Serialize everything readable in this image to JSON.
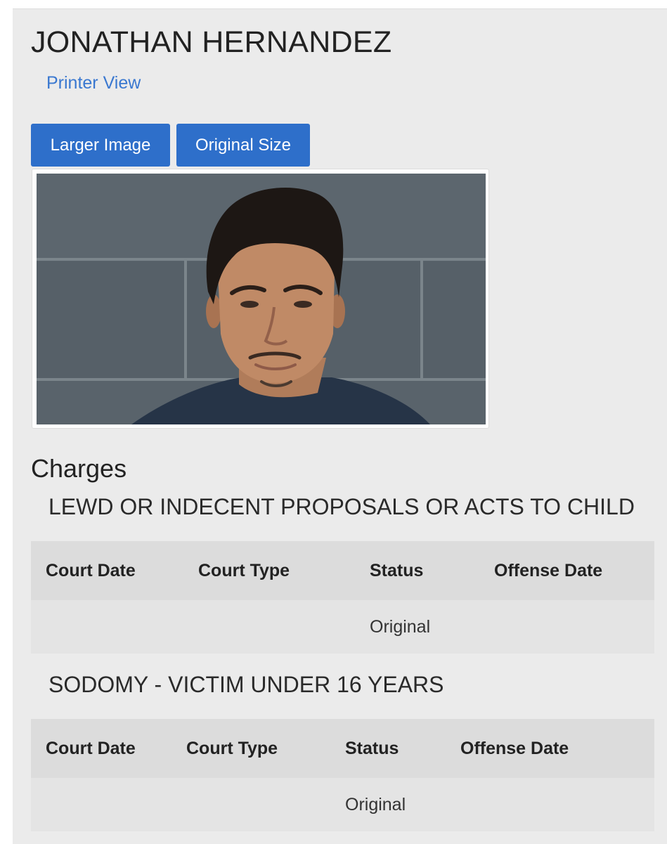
{
  "person": {
    "name": "JONATHAN HERNANDEZ"
  },
  "links": {
    "printer_view": "Printer View"
  },
  "buttons": {
    "larger_image": "Larger Image",
    "original_size": "Original Size"
  },
  "photo": {
    "alt": "Booking photo"
  },
  "charges": {
    "heading": "Charges",
    "items": [
      {
        "name": "LEWD OR INDECENT PROPOSALS OR ACTS TO CHILD",
        "columns": [
          "Court Date",
          "Court Type",
          "Status",
          "Offense Date"
        ],
        "row": {
          "court_date": "",
          "court_type": "",
          "status": "Original",
          "offense_date": ""
        }
      },
      {
        "name": "SODOMY - VICTIM UNDER 16 YEARS",
        "columns": [
          "Court Date",
          "Court Type",
          "Status",
          "Offense Date"
        ],
        "row": {
          "court_date": "",
          "court_type": "",
          "status": "Original",
          "offense_date": ""
        }
      }
    ]
  },
  "colors": {
    "accent": "#2e6fca",
    "link": "#3a78d0",
    "panel_bg": "#ebebeb"
  }
}
